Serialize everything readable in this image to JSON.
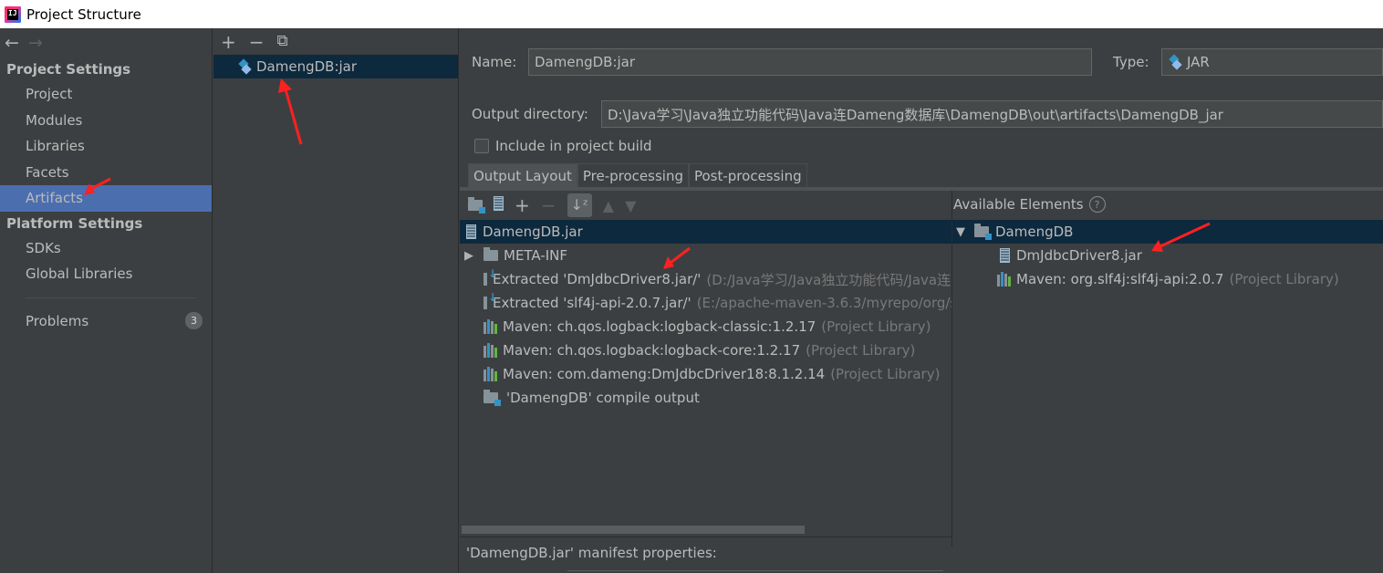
{
  "window": {
    "title": "Project Structure",
    "app_icon_text": "IJ"
  },
  "nav": {
    "back_icon": "←",
    "forward_icon": "→",
    "project_settings_title": "Project Settings",
    "project_items": [
      "Project",
      "Modules",
      "Libraries",
      "Facets",
      "Artifacts"
    ],
    "platform_settings_title": "Platform Settings",
    "platform_items": [
      "SDKs",
      "Global Libraries"
    ],
    "problems_label": "Problems",
    "problems_count": "3",
    "selected_item": "Artifacts"
  },
  "artifacts_panel": {
    "add_icon": "+",
    "remove_icon": "−",
    "copy_icon": "⧉",
    "artifacts": [
      "DamengDB:jar"
    ]
  },
  "editor": {
    "name_label": "Name:",
    "name_value": "DamengDB:jar",
    "type_label": "Type:",
    "type_value": "JAR",
    "output_dir_label": "Output directory:",
    "output_dir_value": "D:\\Java学习\\Java独立功能代码\\Java连Dameng数据库\\DamengDB\\out\\artifacts\\DamengDB_jar",
    "include_build_label": "Include in project build",
    "tabs": [
      "Output Layout",
      "Pre-processing",
      "Post-processing"
    ],
    "active_tab": "Output Layout"
  },
  "output_layout": {
    "root": "DamengDB.jar",
    "items": [
      {
        "icon": "folder",
        "expandable": true,
        "label": "META-INF",
        "extra": ""
      },
      {
        "icon": "extract",
        "expandable": false,
        "label": "Extracted 'DmJdbcDriver8.jar/'",
        "extra": "(D:/Java学习/Java独立功能代码/Java连I"
      },
      {
        "icon": "extract",
        "expandable": false,
        "label": "Extracted 'slf4j-api-2.0.7.jar/'",
        "extra": "(E:/apache-maven-3.6.3/myrepo/org/sl"
      },
      {
        "icon": "library",
        "expandable": false,
        "label": "Maven: ch.qos.logback:logback-classic:1.2.17",
        "extra": "(Project Library)"
      },
      {
        "icon": "library",
        "expandable": false,
        "label": "Maven: ch.qos.logback:logback-core:1.2.17",
        "extra": "(Project Library)"
      },
      {
        "icon": "library",
        "expandable": false,
        "label": "Maven: com.dameng:DmJdbcDriver18:8.1.2.14",
        "extra": "(Project Library)"
      },
      {
        "icon": "module-folder",
        "expandable": false,
        "label": "'DamengDB' compile output",
        "extra": ""
      }
    ],
    "manifest_label": "'DamengDB.jar' manifest properties:"
  },
  "available_elements": {
    "title": "Available Elements",
    "help_icon": "?",
    "root": "DamengDB",
    "items": [
      {
        "icon": "jar",
        "label": "DmJdbcDriver8.jar",
        "extra": ""
      },
      {
        "icon": "library",
        "label": "Maven: org.slf4j:slf4j-api:2.0.7",
        "extra": "(Project Library)"
      }
    ]
  },
  "colors": {
    "background": "#3c3f41",
    "selection": "#4b6eaf",
    "tree_selection": "#0d293e",
    "annotation_arrow": "#ff2020"
  }
}
